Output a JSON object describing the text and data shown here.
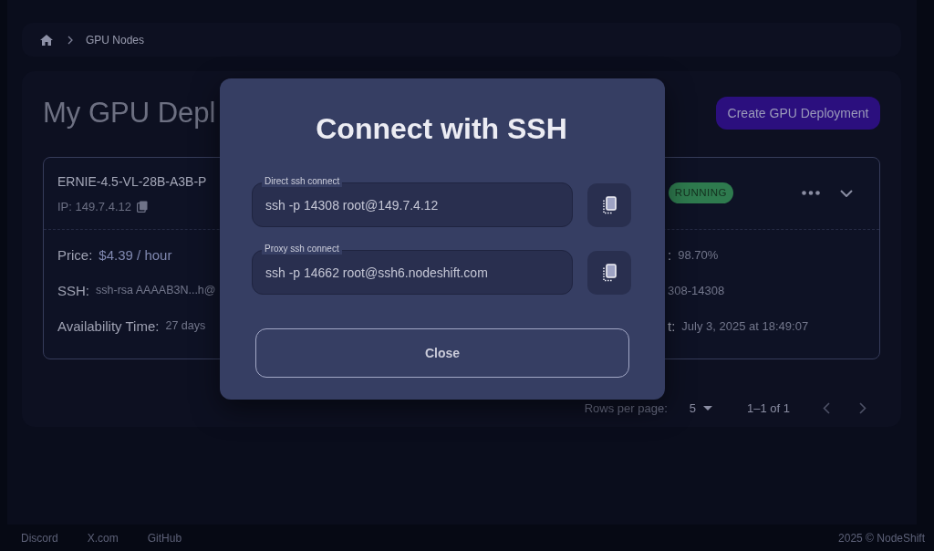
{
  "breadcrumb": {
    "current": "GPU Nodes"
  },
  "page": {
    "title": "My GPU Depl",
    "create_button": "Create GPU Deployment"
  },
  "deployment": {
    "name": "ERNIE-4.5-VL-28B-A3B-P",
    "ip": "IP: 149.7.4.12",
    "status": "RUNNING",
    "details_left": [
      {
        "kind": "price",
        "label": "Price:",
        "value": "$4.39 / hour"
      },
      {
        "kind": "text",
        "label": "SSH:",
        "value": "ssh-rsa AAAAB3N...h@"
      },
      {
        "kind": "text",
        "label": "Availability Time:",
        "value": "27 days"
      }
    ],
    "details_right": [
      {
        "kind": "text",
        "label": ":",
        "value": "98.70%"
      },
      {
        "kind": "text",
        "value": "308-14308"
      },
      {
        "kind": "text",
        "label": "t:",
        "value": "July 3, 2025 at 18:49:07"
      }
    ]
  },
  "pagination": {
    "rows_per_page_label": "Rows per page:",
    "rows_per_page": "5",
    "range": "1–1 of 1"
  },
  "dialog": {
    "title": "Connect with SSH",
    "fields": [
      {
        "label": "Direct ssh connect",
        "value": "ssh -p 14308 root@149.7.4.12"
      },
      {
        "label": "Proxy ssh connect",
        "value": "ssh -p 14662 root@ssh6.nodeshift.com"
      }
    ],
    "close_button": "Close"
  },
  "footer": {
    "links": [
      "Discord",
      "X.com",
      "GitHub"
    ],
    "copyright": "2025 © NodeShift"
  }
}
